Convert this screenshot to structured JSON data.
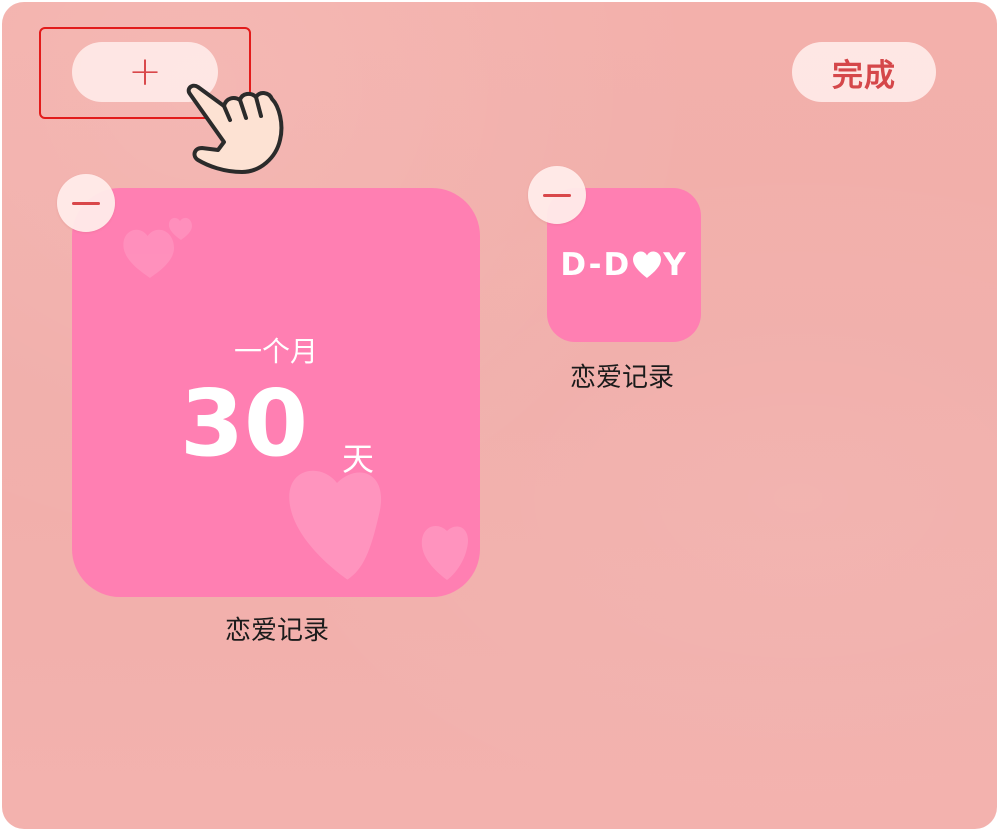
{
  "toolbar": {
    "add_label": "+",
    "done_label": "完成"
  },
  "widgets": [
    {
      "subtitle": "一个月",
      "days": "30",
      "unit": "天",
      "label": "恋爱记录"
    },
    {
      "logo_text_left": "D-D",
      "logo_text_right": "Y",
      "label": "恋爱记录"
    }
  ],
  "colors": {
    "background": "#f3b0ab",
    "widget_pink": "#ff7fb2",
    "accent_red": "#d9474a",
    "highlight": "#e21b1b"
  },
  "icons": [
    "plus-icon",
    "pointing-hand-icon",
    "minus-icon",
    "heart-icon"
  ]
}
